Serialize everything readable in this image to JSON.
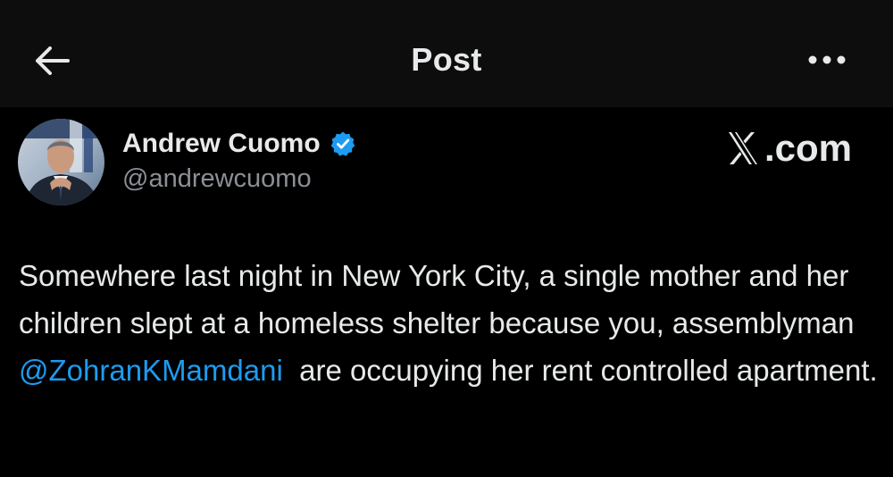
{
  "header": {
    "title": "Post",
    "back_icon": "arrow-left-icon",
    "more_icon": "more-horizontal-icon"
  },
  "author": {
    "display_name": "Andrew Cuomo",
    "handle": "@andrewcuomo",
    "verified": true,
    "verified_color": "#1d9bf0"
  },
  "watermark": {
    "text": ".com",
    "logo": "x-logo-icon"
  },
  "post": {
    "text_before": "Somewhere last night in New York City, a single mother and her children slept at a homeless shelter because you, assemblyman ",
    "mention": "@ZohranKMamdani",
    "text_after": "  are occupying her rent controlled apartment."
  },
  "colors": {
    "background": "#000000",
    "header_background": "#0d0d0d",
    "text": "#e7e9ea",
    "secondary_text": "#8b9096",
    "link": "#1d9bf0"
  }
}
